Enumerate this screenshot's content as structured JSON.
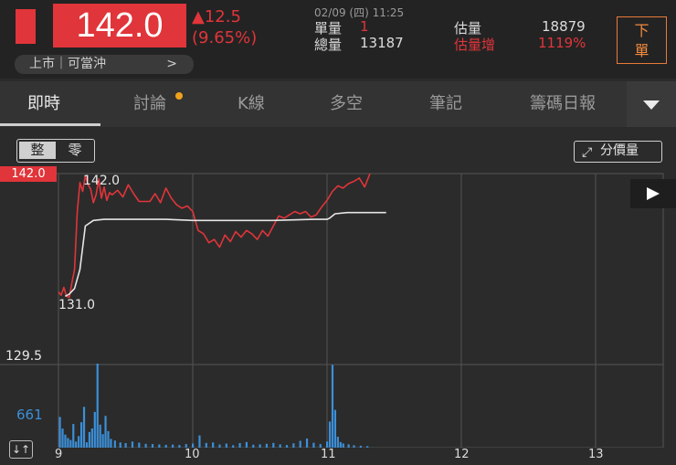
{
  "quote": {
    "price": "142.0",
    "change_abs": "▲12.5",
    "change_pct": "(9.65%)",
    "datetime": "02/09 (四) 11:25",
    "unit_vol_label": "單量",
    "unit_vol_value": "1",
    "total_vol_label": "總量",
    "total_vol_value": "13187",
    "est_label": "估量",
    "est_value": "18879",
    "est_inc_label": "估量增",
    "est_inc_value": "1119%",
    "market_tag": "上市｜可當沖",
    "market_chevron": ">",
    "sell_button": "下\n單"
  },
  "tabs": [
    {
      "label": "即時",
      "active": true
    },
    {
      "label": "討論",
      "active": false,
      "badge": true
    },
    {
      "label": "K線",
      "active": false
    },
    {
      "label": "多空",
      "active": false
    },
    {
      "label": "筆記",
      "active": false
    },
    {
      "label": "籌碼日報",
      "active": false
    }
  ],
  "controls": {
    "toggle_a": "整",
    "toggle_b": "零",
    "price_vol_label": "分價量",
    "expand_icon": "↓↑"
  },
  "colors": {
    "up": "#e0353a",
    "avg": "#e6e6e6",
    "volume": "#3b8fd8",
    "accent_orange": "#f08a3c"
  },
  "chart_data": {
    "type": "line",
    "current_price_label": "142.0",
    "high_label": "142.0",
    "low_label": "131.0",
    "volume_axis_top_label": "129.5",
    "volume_label": "661",
    "x_ticks": [
      "9",
      "10",
      "11",
      "12",
      "13"
    ],
    "ylim": [
      130.7,
      142.0
    ],
    "series": [
      {
        "role": "price",
        "x": [
          9.0,
          9.02,
          9.04,
          9.06,
          9.08,
          9.1,
          9.12,
          9.14,
          9.16,
          9.18,
          9.2,
          9.22,
          9.24,
          9.26,
          9.28,
          9.3,
          9.32,
          9.34,
          9.36,
          9.38,
          9.4,
          9.44,
          9.48,
          9.52,
          9.56,
          9.6,
          9.64,
          9.68,
          9.72,
          9.76,
          9.8,
          9.84,
          9.88,
          9.92,
          9.96,
          10.0,
          10.04,
          10.08,
          10.12,
          10.16,
          10.2,
          10.24,
          10.28,
          10.32,
          10.36,
          10.4,
          10.44,
          10.48,
          10.52,
          10.56,
          10.6,
          10.64,
          10.68,
          10.72,
          10.76,
          10.8,
          10.84,
          10.88,
          10.92,
          10.96,
          11.0,
          11.04,
          11.08,
          11.12,
          11.16,
          11.2,
          11.24,
          11.28,
          11.32
        ],
        "y": [
          131.4,
          131.1,
          131.8,
          131.0,
          130.9,
          132.2,
          133.4,
          138.6,
          141.2,
          140.4,
          141.8,
          141.0,
          140.6,
          139.4,
          140.1,
          141.5,
          139.8,
          140.8,
          139.6,
          140.3,
          140.1,
          140.5,
          139.9,
          141.0,
          140.2,
          139.5,
          139.5,
          139.5,
          140.2,
          139.4,
          140.7,
          139.8,
          139.2,
          138.9,
          139.1,
          138.6,
          136.9,
          136.6,
          135.8,
          136.1,
          135.4,
          136.5,
          135.9,
          136.8,
          136.3,
          136.9,
          136.6,
          136.1,
          136.9,
          136.4,
          137.3,
          138.2,
          138.0,
          138.3,
          138.6,
          138.4,
          138.6,
          138.1,
          138.3,
          139.0,
          139.6,
          140.4,
          140.9,
          140.7,
          141.1,
          141.3,
          141.6,
          140.8,
          142.0
        ]
      },
      {
        "role": "average",
        "x": [
          9.05,
          9.08,
          9.12,
          9.16,
          9.2,
          9.26,
          9.34,
          9.45,
          9.6,
          9.8,
          10.0,
          10.3,
          10.6,
          10.9,
          11.0,
          11.02,
          11.06,
          11.15,
          11.3,
          11.44
        ],
        "y": [
          131.0,
          131.2,
          131.7,
          133.4,
          137.3,
          137.8,
          137.9,
          137.9,
          137.9,
          137.9,
          137.8,
          137.8,
          137.8,
          137.9,
          137.9,
          138.0,
          138.4,
          138.5,
          138.5,
          138.5
        ]
      }
    ],
    "volume": {
      "max": 661,
      "x": [
        9.01,
        9.03,
        9.05,
        9.07,
        9.09,
        9.11,
        9.13,
        9.15,
        9.17,
        9.19,
        9.21,
        9.23,
        9.25,
        9.27,
        9.29,
        9.31,
        9.33,
        9.35,
        9.37,
        9.39,
        9.42,
        9.46,
        9.5,
        9.55,
        9.6,
        9.65,
        9.7,
        9.75,
        9.8,
        9.85,
        9.9,
        9.95,
        10.0,
        10.05,
        10.1,
        10.15,
        10.2,
        10.25,
        10.3,
        10.35,
        10.4,
        10.45,
        10.5,
        10.55,
        10.6,
        10.65,
        10.7,
        10.75,
        10.8,
        10.85,
        10.9,
        10.95,
        11.0,
        11.02,
        11.04,
        11.06,
        11.08,
        11.1,
        11.12,
        11.16,
        11.2,
        11.25,
        11.3
      ],
      "v": [
        241,
        150,
        102,
        76,
        60,
        186,
        48,
        91,
        200,
        321,
        42,
        123,
        151,
        281,
        661,
        181,
        106,
        250,
        130,
        69,
        56,
        41,
        36,
        48,
        39,
        30,
        28,
        25,
        22,
        24,
        21,
        28,
        32,
        96,
        37,
        41,
        25,
        32,
        19,
        36,
        44,
        23,
        26,
        30,
        37,
        26,
        21,
        34,
        54,
        72,
        38,
        28,
        48,
        205,
        650,
        297,
        86,
        44,
        33,
        26,
        19,
        15,
        12
      ]
    }
  }
}
